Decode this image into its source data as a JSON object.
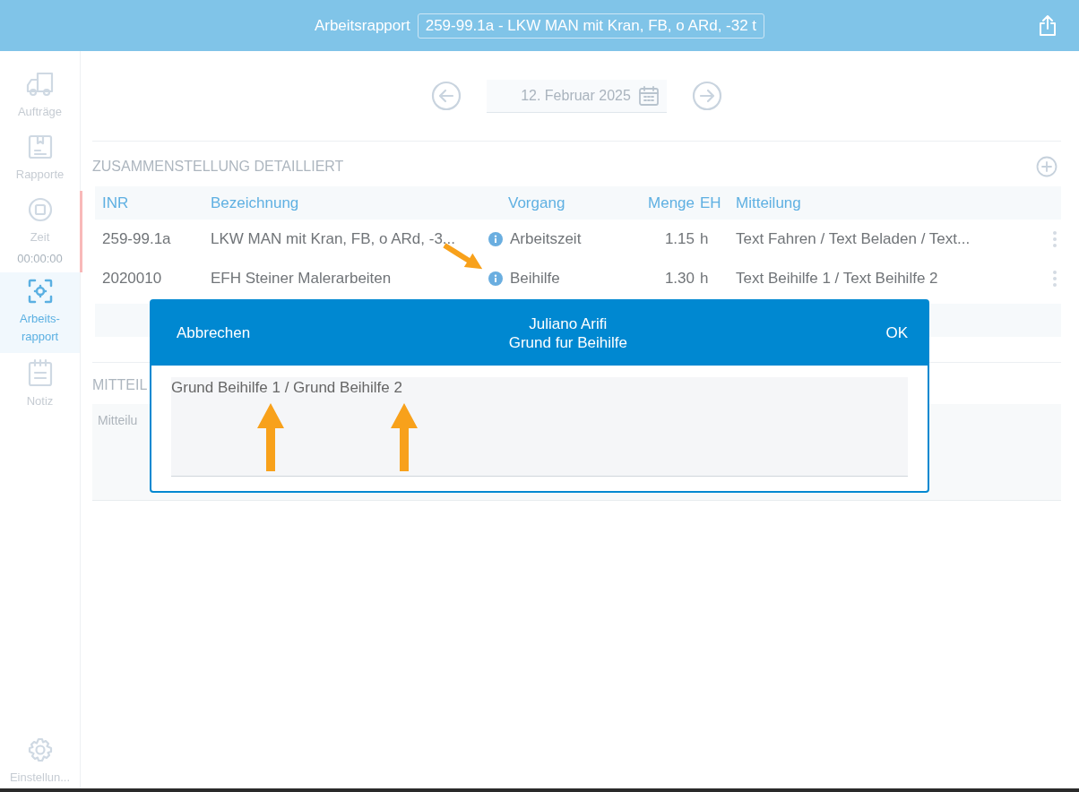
{
  "header": {
    "title": "Arbeitsrapport",
    "order_value": "259-99.1a - LKW MAN mit Kran, FB, o ARd, -32 t"
  },
  "sidebar": {
    "items": [
      {
        "kind": "truck",
        "label": "Aufträge",
        "selected": false
      },
      {
        "kind": "report",
        "label": "Rapporte",
        "selected": false
      },
      {
        "kind": "timer",
        "label": "Zeit",
        "time": "00:00:00",
        "selected": false,
        "running": true
      },
      {
        "kind": "focus",
        "label": "Arbeits-\nrapport",
        "selected": true
      },
      {
        "kind": "note",
        "label": "Notiz",
        "selected": false
      }
    ],
    "settings": {
      "label": "Einstellun..."
    }
  },
  "date_nav": {
    "date": "12. Februar 2025"
  },
  "summary": {
    "title": "ZUSAMMENSTELLUNG DETAILLIERT",
    "columns": [
      "INR",
      "Bezeichnung",
      "Vorgang",
      "Menge",
      "EH",
      "Mitteilung"
    ],
    "rows": [
      {
        "inr": "259-99.1a",
        "bezeichnung": "LKW MAN mit Kran, FB, o ARd, -3...",
        "vorgang": "Arbeitszeit",
        "menge": "1.15",
        "eh": "h",
        "mitteilung": "Text Fahren / Text Beladen / Text..."
      },
      {
        "inr": "2020010",
        "bezeichnung": "EFH Steiner Malerarbeiten",
        "vorgang": "Beihilfe",
        "menge": "1.30",
        "eh": "h",
        "mitteilung": "Text Beihilfe 1 / Text Beihilfe 2"
      }
    ]
  },
  "message": {
    "title": "MITTEIL",
    "placeholder": "Mitteilu"
  },
  "dialog": {
    "cancel": "Abbrechen",
    "title": "Juliano Arifi",
    "subtitle": "Grund fur Beihilfe",
    "ok": "OK",
    "value": "Grund Beihilfe 1 / Grund Beihilfe 2"
  }
}
